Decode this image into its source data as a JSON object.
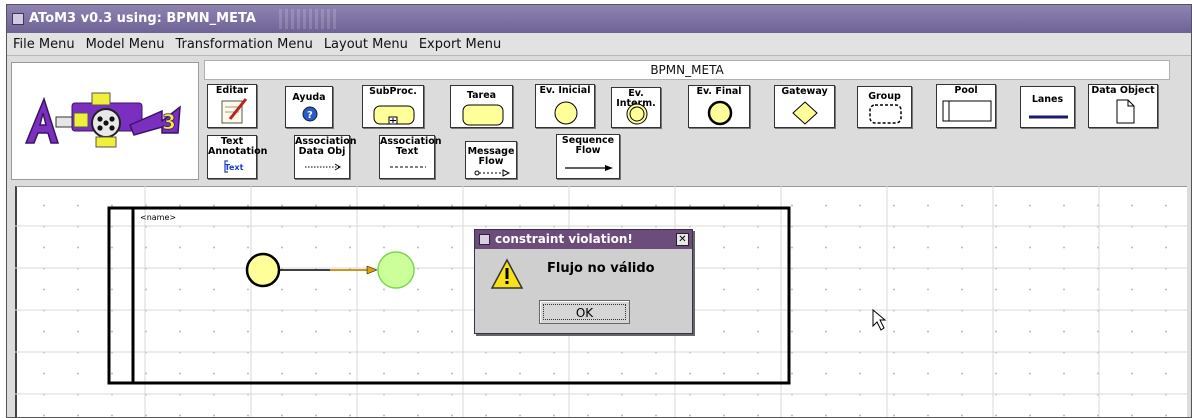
{
  "window": {
    "title": "AToM3 v0.3 using: BPMN_META"
  },
  "menubar": {
    "items": [
      "File Menu",
      "Model Menu",
      "Transformation Menu",
      "Layout Menu",
      "Export Menu"
    ]
  },
  "toolbar": {
    "meta_title": "BPMN_META",
    "logo_text": "AToM3",
    "buttons": {
      "editar": "Editar",
      "ayuda": "Ayuda",
      "subproc": "SubProc.",
      "tarea": "Tarea",
      "ev_inicial": "Ev. Inicial",
      "ev_interm": "Ev. Interm.",
      "ev_final": "Ev. Final",
      "gateway": "Gateway",
      "group": "Group",
      "pool": "Pool",
      "lanes": "Lanes",
      "data_object": "Data Object",
      "text_annotation_1": "Text",
      "text_annotation_2": "Annotation",
      "text_annotation_icon": "Text",
      "assoc_data_1": "Association",
      "assoc_data_2": "Data Obj",
      "assoc_text_1": "Association",
      "assoc_text_2": "Text",
      "message_flow_1": "Message",
      "message_flow_2": "Flow",
      "sequence_flow_1": "Sequence",
      "sequence_flow_2": "Flow"
    }
  },
  "canvas": {
    "pool_name": "<name>"
  },
  "dialog": {
    "title": "constraint violation!",
    "close": "✕",
    "message": "Flujo no válido",
    "ok_label": "OK"
  },
  "colors": {
    "titlebar": "#7a6fa3",
    "dialog_titlebar": "#6b4c7a",
    "start_event": "#ffff99",
    "end_event": "#ccff99",
    "flow_arrow": "#e0a000",
    "logo_purple": "#7b2fbf",
    "logo_yellow": "#f0ef3a"
  }
}
